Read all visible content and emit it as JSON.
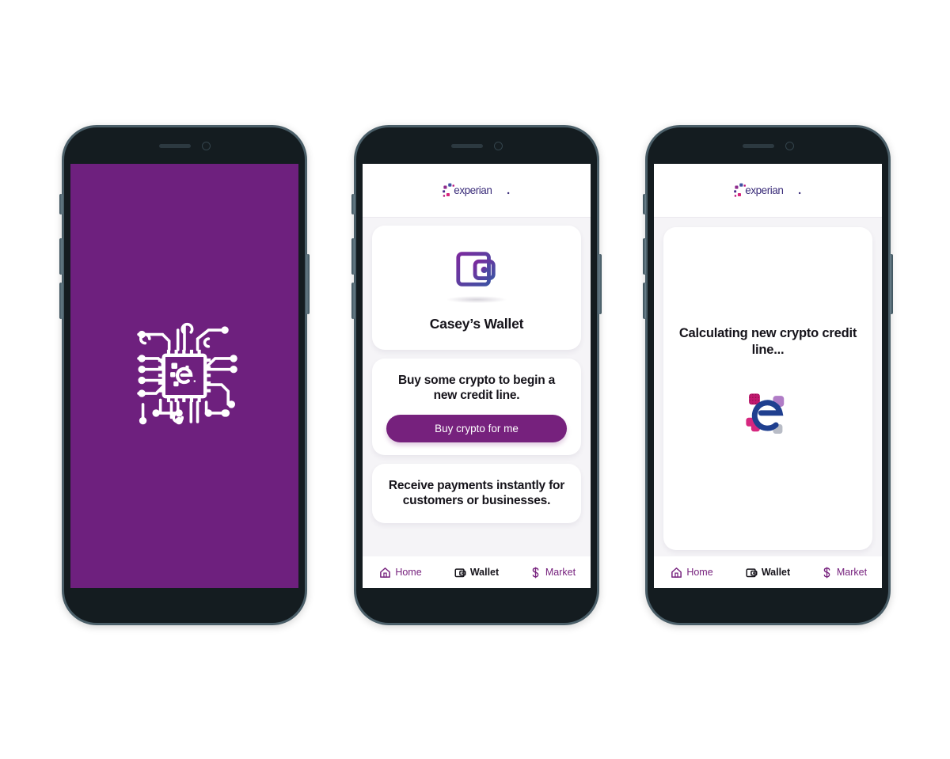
{
  "page": {
    "background_color": "#ffffff",
    "brand_purple": "#76217d",
    "splash_purple": "#6e207e",
    "app_background": "#f5f4f7",
    "card_background": "#ffffff",
    "text_color": "#15131a"
  },
  "brand": {
    "logo_wordmark": "experian",
    "logo_trademark": ".",
    "logo_icon_name": "experian-dots-logo",
    "dot_colors": [
      "#b8157f",
      "#4b2a8c",
      "#7f2a8c",
      "#3f51a3"
    ]
  },
  "phones": [
    {
      "id": "phone-splash",
      "name": "splash-screen-phone",
      "screen_type": "splash",
      "splash": {
        "background_color": "#6e207e",
        "icon_name": "experian-chip-circuit-logo",
        "icon_color": "#ffffff"
      }
    },
    {
      "id": "phone-wallet",
      "name": "wallet-home-phone",
      "screen_type": "app",
      "header": {
        "logo_name": "experian-logo",
        "wordmark": "experian"
      },
      "cards": [
        {
          "name": "wallet-summary-card",
          "icon_name": "wallet-icon",
          "title": "Casey’s Wallet"
        },
        {
          "name": "buy-crypto-card",
          "text": "Buy some crypto to begin a new credit line.",
          "button_label": "Buy crypto for me"
        },
        {
          "name": "receive-payments-card",
          "text": "Receive payments instantly for customers or businesses."
        }
      ]
    },
    {
      "id": "phone-calculating",
      "name": "calculating-credit-line-phone",
      "screen_type": "app",
      "header": {
        "logo_name": "experian-logo",
        "wordmark": "experian"
      },
      "calculating": {
        "name": "calculating-card",
        "title": "Calculating new crypto credit line...",
        "spinner_name": "experian-loading-spinner",
        "spinner_colors": [
          "#c2186f",
          "#b07cc6",
          "#d6277f",
          "#b8bcc6",
          "#1f3f8f"
        ]
      }
    }
  ],
  "tabbar": {
    "items": [
      {
        "label": "Home",
        "icon": "home-icon",
        "active": false
      },
      {
        "label": "Wallet",
        "icon": "wallet-icon",
        "active": true
      },
      {
        "label": "Market",
        "icon": "dollar-icon",
        "active": false
      }
    ]
  }
}
